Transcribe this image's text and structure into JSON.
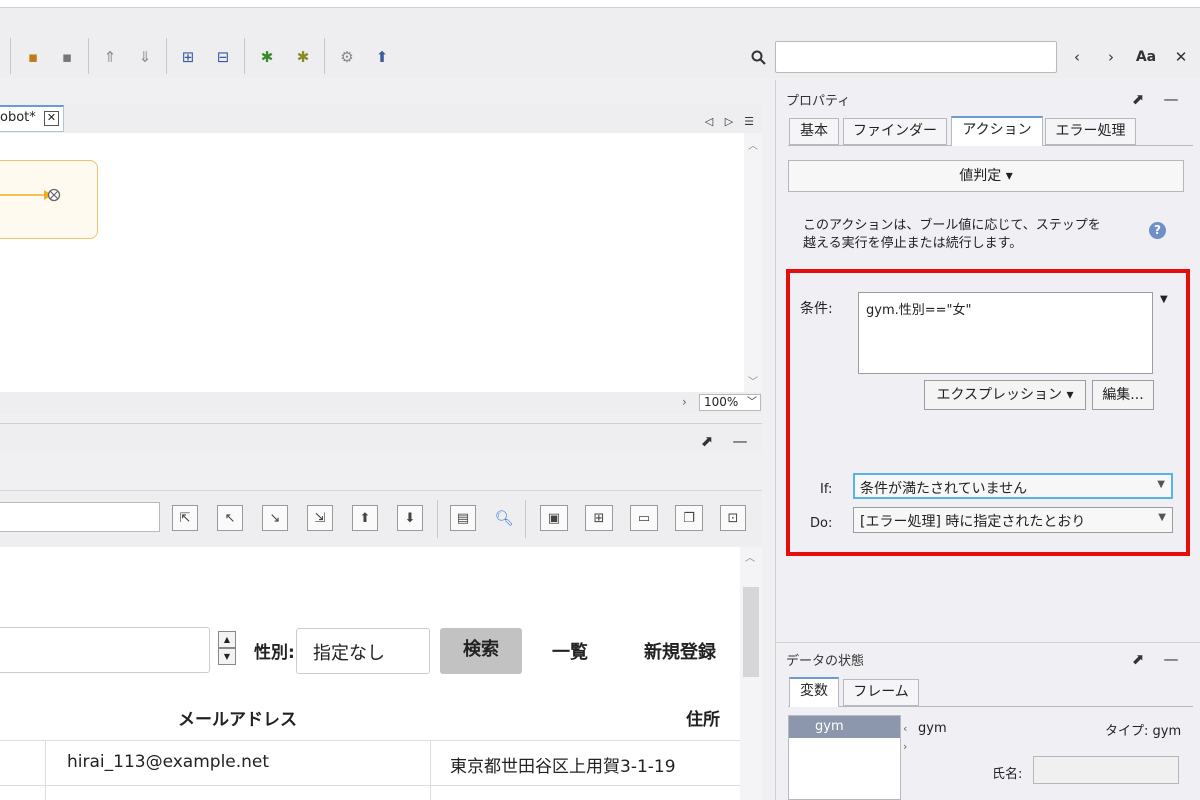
{
  "editor": {
    "tab_label": "obot*",
    "close_glyph": "✕",
    "zoom": "100%"
  },
  "properties": {
    "title": "プロパティ",
    "tabs": [
      "基本",
      "ファインダー",
      "アクション",
      "エラー処理"
    ],
    "action_dropdown": "値判定 ▾",
    "description_line1": "このアクションは、ブール値に応じて、ステップを",
    "description_line2": "越える実行を停止または続行します。",
    "condition_label": "条件:",
    "condition_value": "gym.性別==\"女\"",
    "expression_button": "エクスプレッション ▾",
    "edit_button": "編集...",
    "if_label": "If:",
    "if_value": "条件が満たされていません",
    "do_label": "Do:",
    "do_value": "[エラー処理] 時に指定されたとおり",
    "help_glyph": "?"
  },
  "data_state": {
    "title": "データの状態",
    "tabs": [
      "変数",
      "フレーム"
    ],
    "variable": "gym",
    "var_name": "gym",
    "type_label": "タイプ: gym",
    "name_label": "氏名:"
  },
  "browser": {
    "gender_label": "性別:",
    "gender_value": "指定なし",
    "search_button": "検索",
    "list_link": "一覧",
    "new_link": "新規登録",
    "col_mail": "メールアドレス",
    "col_addr": "住所",
    "row_mail": "hirai_113@example.net",
    "row_addr": "東京都世田谷区上用賀3-1-19"
  },
  "toolbar": {
    "case_button": "Aa"
  },
  "colors": {
    "highlight_border": "#e60d0d",
    "active_tab": "#6b9bd1",
    "selected_var": "#8c97ad"
  }
}
